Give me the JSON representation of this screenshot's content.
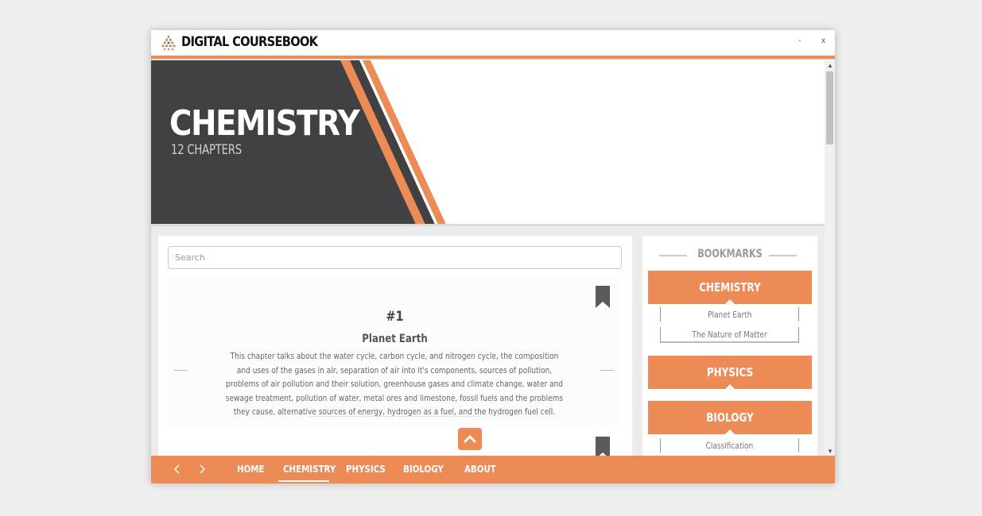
{
  "app": {
    "title": "DIGITAL COURSEBOOK",
    "minimize_label": "-",
    "close_label": "x"
  },
  "hero": {
    "title": "CHEMISTRY",
    "subtitle": "12 CHAPTERS"
  },
  "search": {
    "placeholder": "Search",
    "value": ""
  },
  "chapter": {
    "number": "#1",
    "title": "Planet Earth",
    "description": "This chapter talks about the water cycle, carbon cycle, and nitrogen cycle, the composition and uses of the gases in air, separation of air into it's components, sources of pollution, problems of air pollution and their solution, greenhouse gases and climate change, water and sewage treatment, pollution of water, metal ores and limestone, fossil fuels and the problems they cause, alternative sources of energy, hydrogen as a fuel, and the hydrogen fuel cell."
  },
  "bookmarks": {
    "heading": "BOOKMARKS",
    "categories": [
      {
        "name": "CHEMISTRY",
        "items": [
          "Planet Earth",
          "The Nature of Matter"
        ]
      },
      {
        "name": "PHYSICS",
        "items": []
      },
      {
        "name": "BIOLOGY",
        "items": [
          "Classification"
        ]
      }
    ]
  },
  "nav": {
    "links": [
      "HOME",
      "CHEMISTRY",
      "PHYSICS",
      "BIOLOGY",
      "ABOUT"
    ],
    "active": "CHEMISTRY"
  },
  "colors": {
    "accent": "#ec8b56",
    "hero_dark": "#414042",
    "bookmark_flag": "#5a5a5a"
  },
  "icons": {
    "logo": "geodesic-triangle-logo-icon",
    "bookmark": "bookmark-ribbon-icon",
    "scroll_top": "chevron-up-icon",
    "nav_prev": "chevron-left-icon",
    "nav_next": "chevron-right-icon"
  }
}
